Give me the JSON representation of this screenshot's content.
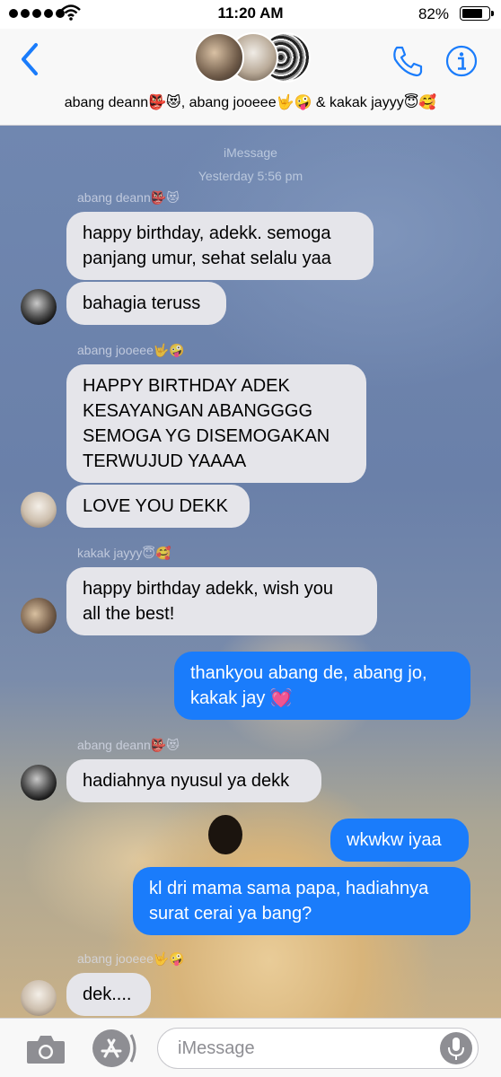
{
  "status_bar": {
    "time": "11:20 AM",
    "battery_percent": "82%",
    "battery_level": 0.82
  },
  "header": {
    "group_title": "abang deann👺😻, abang jooeee🤟🤪 & kakak jayyy😇🥰",
    "icons": [
      "back-chevron-icon",
      "phone-icon",
      "info-icon"
    ]
  },
  "chat": {
    "service_label": "iMessage",
    "timestamp": "Yesterday 5:56 pm",
    "messages": [
      {
        "sender": "abang deann👺😻",
        "text_lines": [
          "happy birthday, adekk. semoga",
          "panjang umur, sehat selalu yaa"
        ]
      },
      {
        "text_lines": [
          "bahagia teruss"
        ]
      },
      {
        "sender": "abang jooeee🤟🤪",
        "text_lines": [
          "HAPPY BIRTHDAY ADEK",
          "KESAYANGAN ABANGGGG",
          "SEMOGA YG DISEMOGAKAN",
          "TERWUJUD YAAAA"
        ]
      },
      {
        "text_lines": [
          "LOVE YOU DEKK"
        ]
      },
      {
        "sender": "kakak jayyy😇🥰",
        "text_lines": [
          "happy birthday adekk, wish you",
          "all the best!"
        ]
      },
      {
        "text_lines": [
          "thankyou abang de, abang jo,",
          "kakak jay 💓"
        ]
      },
      {
        "sender": "abang deann👺😻",
        "text_lines": [
          "hadiahnya nyusul ya dekk"
        ]
      },
      {
        "text_lines": [
          "wkwkw iyaa"
        ]
      },
      {
        "text_lines": [
          "kl dri mama sama papa, hadiahnya",
          "surat cerai ya bang?"
        ]
      },
      {
        "sender": "abang jooeee🤟🤪",
        "text_lines": [
          "dek...."
        ]
      }
    ]
  },
  "input_bar": {
    "placeholder": "iMessage",
    "icons": [
      "camera-icon",
      "app-store-icon",
      "microphone-icon"
    ]
  },
  "colors": {
    "accent": "#1a7cfb",
    "incoming_bubble": "#e5e5ea"
  }
}
